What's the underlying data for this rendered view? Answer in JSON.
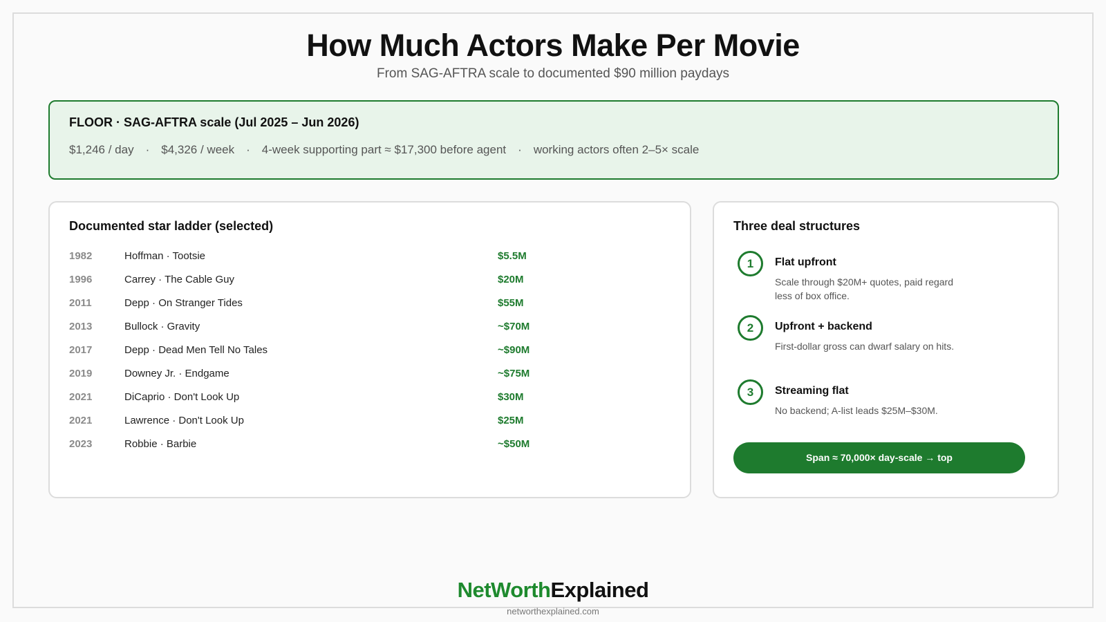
{
  "header": {
    "title": "How Much Actors Make Per Movie",
    "subtitle": "From SAG-AFTRA scale to documented $90 million paydays"
  },
  "floor": {
    "heading": "FLOOR · SAG-AFTRA scale (Jul 2025 – Jun 2026)",
    "separator": "·",
    "details": [
      "$1,246 / day",
      "$4,326 / week",
      "4-week supporting part ≈ $17,300 before agent",
      "working actors often 2–5× scale"
    ]
  },
  "ladder": {
    "title": "Documented star ladder (selected)",
    "rows": [
      {
        "year": "1982",
        "film": "Hoffman · Tootsie",
        "pay": "$5.5M"
      },
      {
        "year": "1996",
        "film": "Carrey · The Cable Guy",
        "pay": "$20M"
      },
      {
        "year": "2011",
        "film": "Depp · On Stranger Tides",
        "pay": "$55M"
      },
      {
        "year": "2013",
        "film": "Bullock · Gravity",
        "pay": "~$70M"
      },
      {
        "year": "2017",
        "film": "Depp · Dead Men Tell No Tales",
        "pay": "~$90M"
      },
      {
        "year": "2019",
        "film": "Downey Jr. · Endgame",
        "pay": "~$75M"
      },
      {
        "year": "2021",
        "film": "DiCaprio · Don't Look Up",
        "pay": "$30M"
      },
      {
        "year": "2021",
        "film": "Lawrence · Don't Look Up",
        "pay": "$25M"
      },
      {
        "year": "2023",
        "film": "Robbie · Barbie",
        "pay": "~$50M"
      }
    ]
  },
  "deals": {
    "title": "Three deal structures",
    "items": [
      {
        "num": "1",
        "title": "Flat upfront",
        "desc": "Scale through $20M+ quotes, paid regardless of box office."
      },
      {
        "num": "2",
        "title": "Upfront + backend",
        "desc": "First-dollar gross can dwarf salary on hits."
      },
      {
        "num": "3",
        "title": "Streaming flat",
        "desc": "No backend; A-list leads $25M–$30M."
      }
    ],
    "span_label": "Span ≈ 70,000× day-scale → top"
  },
  "footer": {
    "brand_part1": "NetWorth",
    "brand_part2": "Explained",
    "site": "networthexplained.com"
  },
  "colors": {
    "accent": "#1e7b2e",
    "floor_bg": "#e8f4ea"
  }
}
